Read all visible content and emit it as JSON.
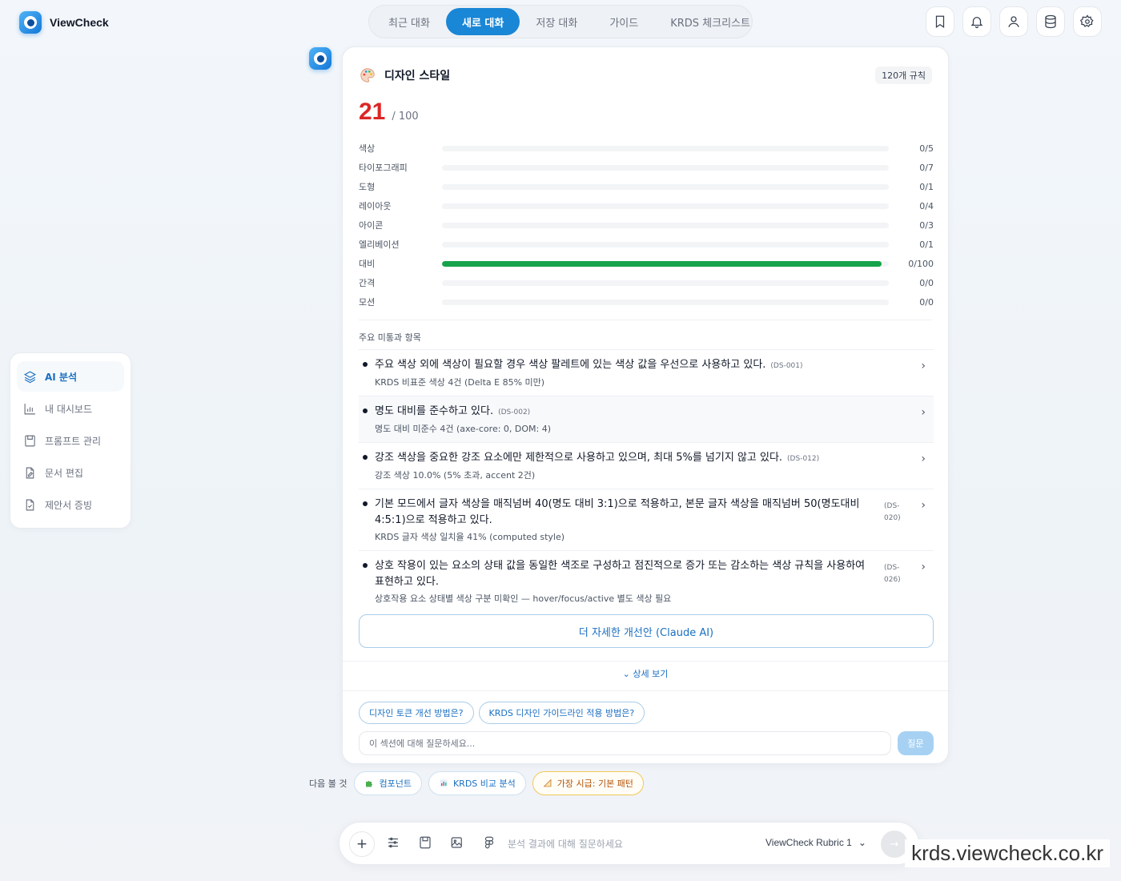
{
  "brand": {
    "name": "ViewCheck"
  },
  "tabs": [
    {
      "label": "최근 대화",
      "active": false
    },
    {
      "label": "새로 대화",
      "active": true
    },
    {
      "label": "저장 대화",
      "active": false
    },
    {
      "label": "가이드",
      "active": false
    },
    {
      "label": "KRDS 체크리스트",
      "active": false
    }
  ],
  "top_actions": [
    "bookmark-icon",
    "bell-icon",
    "user-icon",
    "database-icon",
    "gear-icon"
  ],
  "sidebar": {
    "items": [
      {
        "label": "AI 분석",
        "icon": "layers-icon",
        "active": true
      },
      {
        "label": "내 대시보드",
        "icon": "bar-chart-icon",
        "active": false
      },
      {
        "label": "프롬프트 관리",
        "icon": "save-icon",
        "active": false
      },
      {
        "label": "문서 편집",
        "icon": "document-edit-icon",
        "active": false
      },
      {
        "label": "제안서 증빙",
        "icon": "document-check-icon",
        "active": false
      }
    ]
  },
  "card": {
    "title": "디자인 스타일",
    "rule_count": "120개 규칙",
    "score": "21",
    "score_max": "/ 100",
    "bars": [
      {
        "label": "색상",
        "value": "0/5",
        "fill": 0
      },
      {
        "label": "타이포그래피",
        "value": "0/7",
        "fill": 0
      },
      {
        "label": "도형",
        "value": "0/1",
        "fill": 0
      },
      {
        "label": "레이아웃",
        "value": "0/4",
        "fill": 0
      },
      {
        "label": "아이콘",
        "value": "0/3",
        "fill": 0
      },
      {
        "label": "엘리베이션",
        "value": "0/1",
        "fill": 0
      },
      {
        "label": "대비",
        "value": "0/100",
        "fill": 0.984
      },
      {
        "label": "간격",
        "value": "0/0",
        "fill": 0
      },
      {
        "label": "모션",
        "value": "0/0",
        "fill": 0
      }
    ],
    "section_title": "주요 미통과 항목",
    "issues": [
      {
        "text": "주요 색상 외에 색상이 필요할 경우 색상 팔레트에 있는 색상 값을 우선으로 사용하고 있다.",
        "code": "(DS-001)",
        "sub": "KRDS 비표준 색상 4건 (Delta E 85% 미만)",
        "shaded": false,
        "code_side": false
      },
      {
        "text": "명도 대비를 준수하고 있다.",
        "code": "(DS-002)",
        "sub": "명도 대비 미준수 4건 (axe-core: 0, DOM: 4)",
        "shaded": true,
        "code_side": false
      },
      {
        "text": "강조 색상을 중요한 강조 요소에만 제한적으로 사용하고 있으며, 최대 5%를 넘기지 않고 있다.",
        "code": "(DS-012)",
        "sub": "강조 색상 10.0% (5% 초과, accent 2건)",
        "shaded": false,
        "code_side": false
      },
      {
        "text": "기본 모드에서 글자 색상을 매직넘버 40(명도 대비 3:1)으로 적용하고, 본문 글자 색상을 매직넘버 50(명도대비 4:5:1)으로 적용하고 있다.",
        "code": "(DS-020)",
        "sub": "KRDS 글자 색상 일치율 41% (computed style)",
        "shaded": false,
        "code_side": true
      },
      {
        "text": "상호 작용이 있는 요소의 상태 값을 동일한 색조로 구성하고 점진적으로 증가 또는 감소하는 색상 규칙을 사용하여 표현하고 있다.",
        "code": "(DS-026)",
        "sub": "상호작용 요소 상태별 색상 구분 미확인 — hover/focus/active 별도 색상 필요",
        "shaded": false,
        "code_side": true
      }
    ],
    "claude_button": "더 자세한 개선안 (Claude AI)",
    "detail_toggle": "상세 보기",
    "suggestions": [
      "디자인 토큰 개선 방법은?",
      "KRDS 디자인 가이드라인 적용 방법은?"
    ],
    "ask_placeholder": "이 섹션에 대해 질문하세요...",
    "ask_button": "질문"
  },
  "next": {
    "label": "다음 볼 것",
    "chips": [
      {
        "label": "컴포넌트",
        "icon": "puzzle-icon",
        "warn": false
      },
      {
        "label": "KRDS 비교 분석",
        "icon": "chart-icon",
        "warn": false
      },
      {
        "label": "가장 시급: 기본 패턴",
        "icon": "ruler-icon",
        "warn": true
      }
    ]
  },
  "composer": {
    "placeholder": "분석 결과에 대해 질문하세요",
    "model": "ViewCheck Rubric 1",
    "tools": [
      "plus-icon",
      "sliders-icon",
      "save-icon",
      "image-edit-icon",
      "figma-icon"
    ]
  },
  "watermark": "krds.viewcheck.co.kr",
  "colors": {
    "accent": "#1a86d6",
    "score": "#dc2626",
    "bar_fill": "#16a34a",
    "warn": "#b45309"
  }
}
